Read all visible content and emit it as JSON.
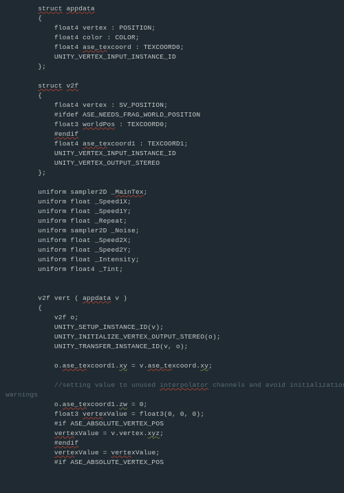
{
  "code": {
    "l01a": "struct",
    "l01b": "appdata",
    "l02": "{",
    "l03": "float4 vertex : POSITION;",
    "l04": "float4 color : COLOR;",
    "l05a": "float4 ",
    "l05b": "ase_te",
    "l05c": "xcoord : TEXCOORD0;",
    "l06": "UNITY_VERTEX_INPUT_INSTANCE_ID",
    "l07": "};",
    "l09a": "struct",
    "l09b": "v2f",
    "l10": "{",
    "l11": "float4 vertex : SV_POSITION;",
    "l12": "#ifdef ASE_NEEDS_FRAG_WORLD_POSITION",
    "l13a": "float3 ",
    "l13b": "worldPos",
    "l13c": " : TEXCOORD0;",
    "l14": "#endif",
    "l15a": "float4 ",
    "l15b": "ase_te",
    "l15c": "xcoord1 : TEXCOORD1;",
    "l16": "UNITY_VERTEX_INPUT_INSTANCE_ID",
    "l17": "UNITY_VERTEX_OUTPUT_STEREO",
    "l18": "};",
    "l20a": "uniform sampler2D ",
    "l20b": "_",
    "l20c": "MainTex",
    ";": ";",
    "l21": "uniform float _Speed1X;",
    "l22": "uniform float _Speed1Y;",
    "l23": "uniform float _Repeat;",
    "l24": "uniform sampler2D _Noise;",
    "l25": "uniform float _Speed2X;",
    "l26": "uniform float _Speed2Y;",
    "l27": "uniform float _Intensity;",
    "l28": "uniform float4 _Tint;",
    "l31a": "v2f vert ( ",
    "l31b": "appdata",
    "l31c": " v )",
    "l32": "{",
    "l33": "v2f o;",
    "l34": "UNITY_SETUP_INSTANCE_ID(v);",
    "l35": "UNITY_INITIALIZE_VERTEX_OUTPUT_STEREO(o);",
    "l36": "UNITY_TRANSFER_INSTANCE_ID(v, o);",
    "l38a": "o.",
    "l38b": "ase_te",
    "l38c": "xcoord1.",
    "l38d": "xy",
    "l38e": " = v.",
    "l38f": "ase_te",
    "l38g": "xcoord.",
    "l38h": "xy",
    "l38i": ";",
    "l40a": "//setting value to unused ",
    "l40b": "interpolator",
    "l40c": " channels and avoid initialization",
    "l40d": "warnings",
    "l42a": "o.",
    "l42b": "ase_te",
    "l42c": "xcoord1.",
    "l42d": "zw",
    "l42e": " = 0;",
    "l43a": "float3 ",
    "l43b": "verte",
    "l43c": "xValue = float3(0, 0, 0);",
    "l44": "#if ASE_ABSOLUTE_VERTEX_POS",
    "l45a": "verte",
    "l45b": "xValue = v.vertex.",
    "l45c": "xyz",
    "l45d": ";",
    "l46": "#endif",
    "l47a": "verte",
    "l47b": "xValue = ",
    "l47c": "verte",
    "l47d": "xValue;",
    "l48": "#if ASE_ABSOLUTE_VERTEX_POS"
  }
}
